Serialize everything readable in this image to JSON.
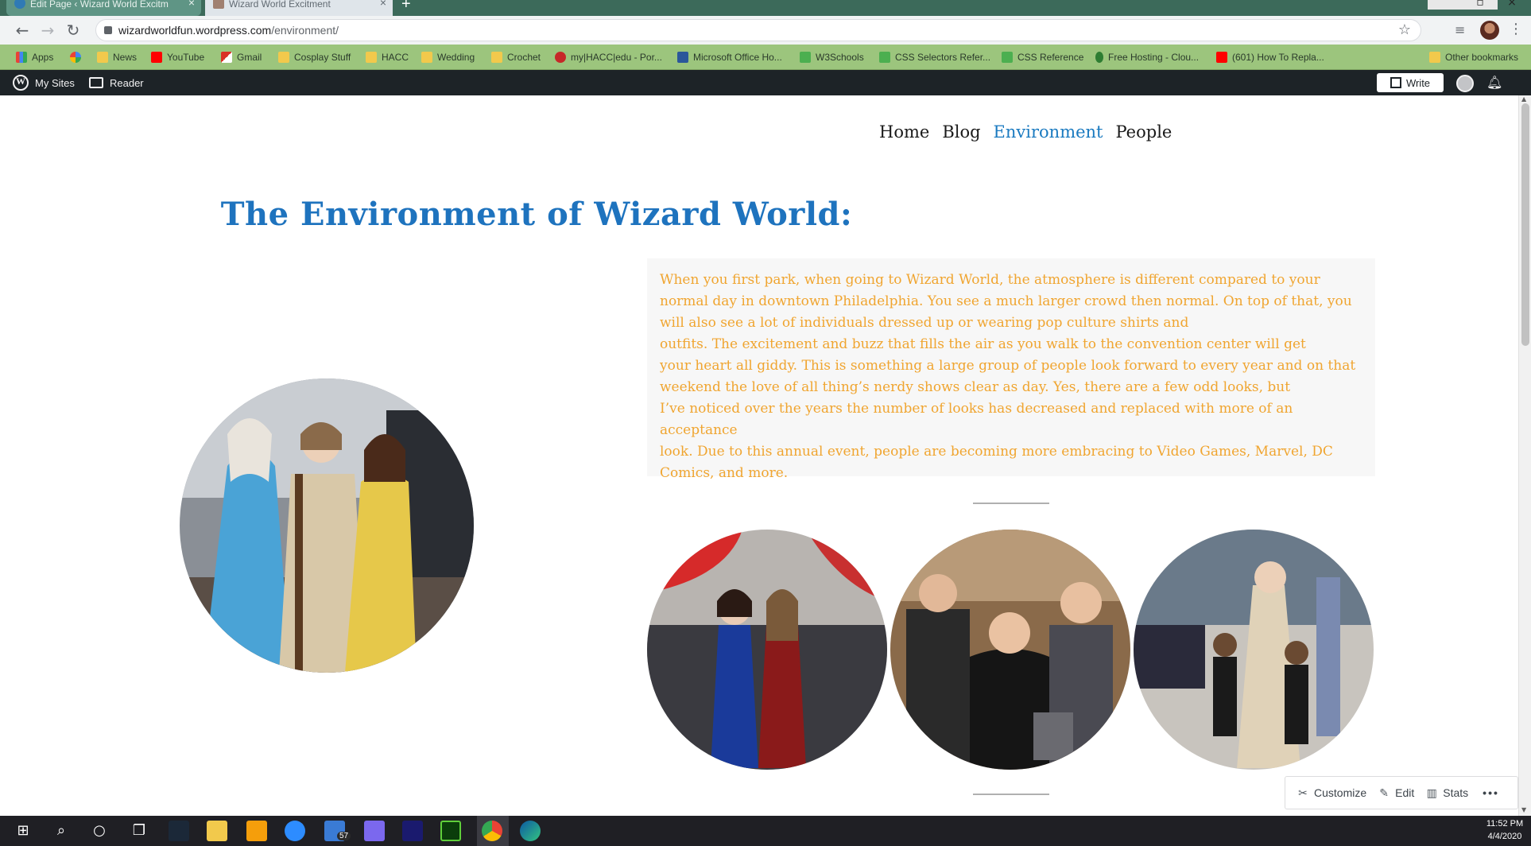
{
  "browser": {
    "tabs": [
      {
        "title": "Edit Page ‹ Wizard World Excitm",
        "active": true
      },
      {
        "title": "Wizard World Excitment",
        "active": false
      }
    ],
    "url_host": "wizardworldfun.wordpress.com",
    "url_path": "/environment/",
    "bookmarks": [
      {
        "label": "Apps",
        "icon": "apps-grid-icon"
      },
      {
        "label": "",
        "icon": "google-icon"
      },
      {
        "label": "News",
        "icon": "folder-icon"
      },
      {
        "label": "YouTube",
        "icon": "youtube-icon"
      },
      {
        "label": "Gmail",
        "icon": "gmail-icon"
      },
      {
        "label": "Cosplay Stuff",
        "icon": "folder-icon"
      },
      {
        "label": "HACC",
        "icon": "folder-icon"
      },
      {
        "label": "Wedding",
        "icon": "folder-icon"
      },
      {
        "label": "Crochet",
        "icon": "folder-icon"
      },
      {
        "label": "my|HACC|edu - Por...",
        "icon": "hacc-icon"
      },
      {
        "label": "Microsoft Office Ho...",
        "icon": "word-icon"
      },
      {
        "label": "W3Schools",
        "icon": "w3schools-icon"
      },
      {
        "label": "CSS Selectors Refer...",
        "icon": "w3schools-icon"
      },
      {
        "label": "CSS Reference",
        "icon": "w3schools-icon"
      },
      {
        "label": "Free Hosting - Clou...",
        "icon": "cloudaccess-icon"
      },
      {
        "label": "(601) How To Repla...",
        "icon": "youtube-icon"
      },
      {
        "label": "Other bookmarks",
        "icon": "folder-icon"
      }
    ]
  },
  "wpbar": {
    "my_sites": "My Sites",
    "reader": "Reader",
    "write": "Write"
  },
  "site": {
    "nav": [
      "Home",
      "Blog",
      "Environment",
      "People"
    ],
    "active_nav": "Environment",
    "title": "The Environment of Wizard World:",
    "paragraph_lines": [
      "When you first park, when going to Wizard World, the atmosphere is different compared to your",
      "normal day in downtown Philadelphia. You see a much larger crowd then normal. On top of that, you",
      "will also see a lot of individuals dressed up or wearing pop culture shirts and",
      "outfits. The excitement and buzz that fills the air as you walk to the convention center will get",
      "your heart all giddy. This is something a large group of people look forward to every year and on that",
      "weekend the love of all thing’s nerdy shows clear as day. Yes, there are a few odd looks, but",
      "I’ve noticed over the years the number of looks has decreased and replaced with more of an acceptance",
      "look. Due to this annual event, people are becoming more embracing to Video Games, Marvel, DC",
      "Comics, and more."
    ]
  },
  "edit_toolbar": {
    "customize": "Customize",
    "edit": "Edit",
    "stats": "Stats"
  },
  "taskbar": {
    "mail_badge": "57",
    "time": "11:52 PM",
    "date": "4/4/2020"
  },
  "colors": {
    "title_blue": "#1e73be",
    "text_orange": "#f0a530",
    "nav_active": "#1a7ac0",
    "bookmarks_green": "#9cc57d",
    "wp_bar": "#1d2327"
  }
}
